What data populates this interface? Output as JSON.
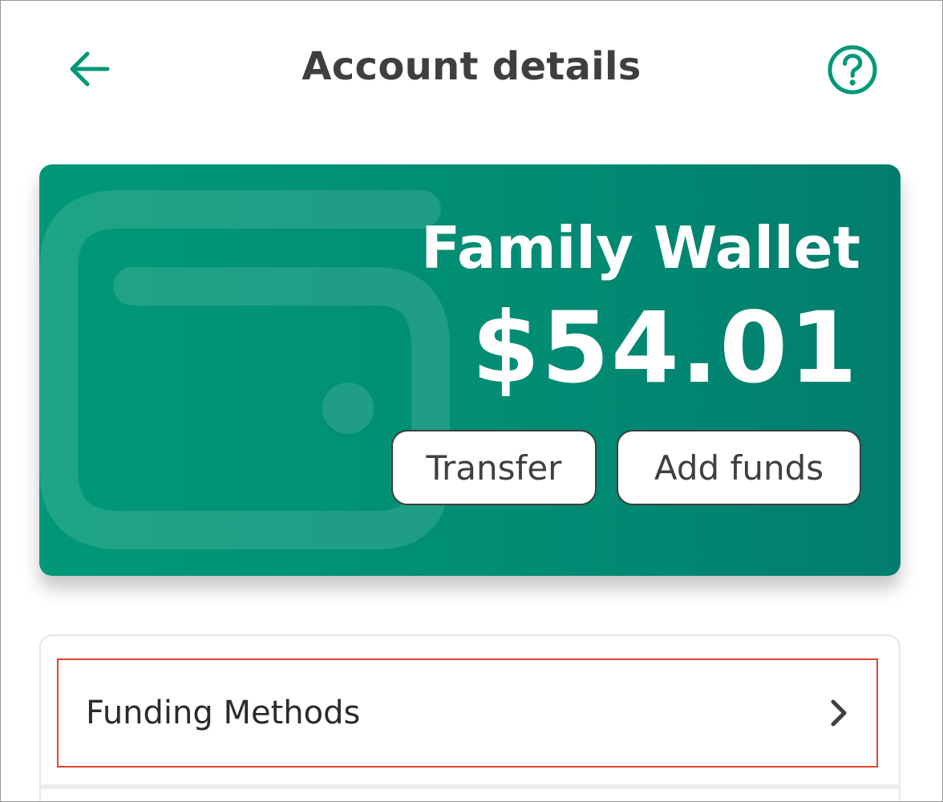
{
  "header": {
    "title": "Account details",
    "back_icon": "arrow-left-icon",
    "help_icon": "question-circle-icon"
  },
  "wallet": {
    "name": "Family Wallet",
    "balance": "$54.01",
    "watermark_icon": "wallet-icon",
    "buttons": {
      "transfer": "Transfer",
      "add_funds": "Add funds"
    }
  },
  "list": {
    "items": [
      {
        "label": "Funding Methods",
        "icon": "chevron-right-icon"
      }
    ]
  },
  "colors": {
    "accent": "#009877",
    "card_dark": "#017d6d",
    "title_text": "#3f3f3f",
    "highlight_border": "#e5432f"
  }
}
